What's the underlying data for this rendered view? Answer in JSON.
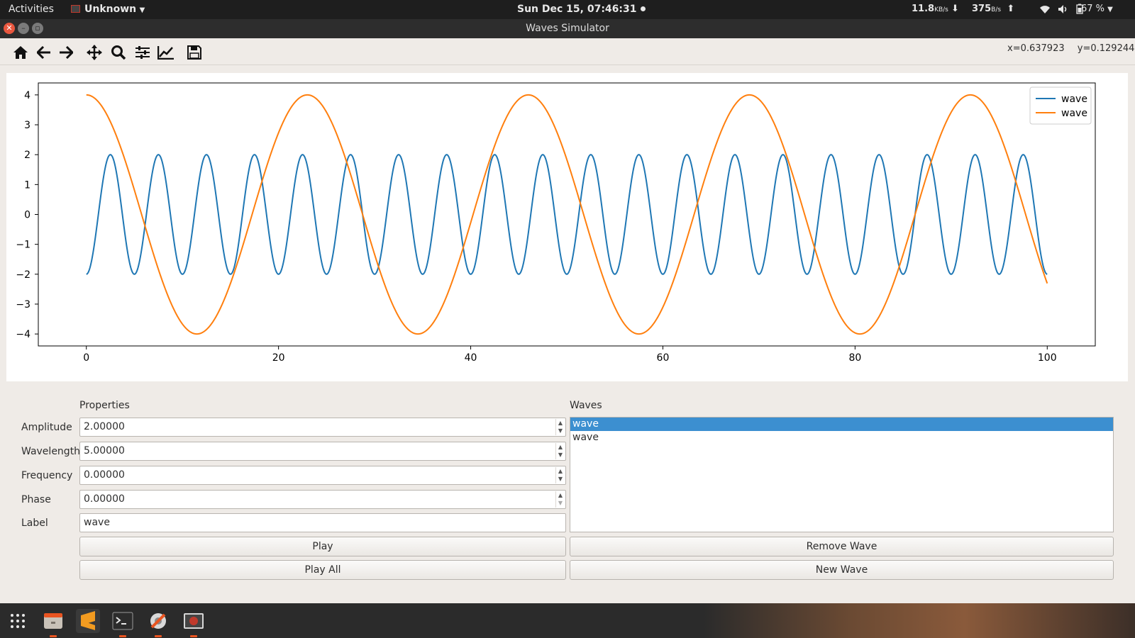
{
  "topbar": {
    "activities": "Activities",
    "app_menu": "Unknown",
    "clock": "Sun Dec 15, 07:46:31",
    "net_down_value": "11.8",
    "net_down_unit": "KB/s",
    "net_up_value": "375",
    "net_up_unit": "B/s",
    "battery": "67 %"
  },
  "window": {
    "title": "Waves Simulator"
  },
  "toolbar": {
    "icons": [
      "home-icon",
      "back-arrow-icon",
      "forward-arrow-icon",
      "pan-icon",
      "zoom-icon",
      "configure-subplots-icon",
      "edit-axis-icon",
      "save-icon"
    ],
    "coord_x": "x=0.637923",
    "coord_y": "y=0.129244"
  },
  "chart_data": {
    "type": "line",
    "title": "",
    "xlabel": "",
    "ylabel": "",
    "xlim": [
      -5,
      105
    ],
    "ylim": [
      -4.4,
      4.4
    ],
    "xticks": [
      0,
      20,
      40,
      60,
      80,
      100
    ],
    "yticks": [
      4,
      3,
      2,
      1,
      0,
      -1,
      -2,
      -3,
      -4
    ],
    "ytick_labels": [
      "4",
      "3",
      "2",
      "1",
      "0",
      "−1",
      "−2",
      "−3",
      "−4"
    ],
    "legend_position": "top-right",
    "grid": false,
    "series": [
      {
        "name": "wave",
        "color": "#1f77b4",
        "amplitude": 2,
        "wavelength": 5,
        "phase": 0,
        "x_range": [
          0,
          100
        ],
        "function": "-A*cos(2*pi*x/wavelength)"
      },
      {
        "name": "wave",
        "color": "#ff7f0e",
        "amplitude": 4,
        "wavelength": 23,
        "phase": 0,
        "x_range": [
          0,
          100
        ],
        "function": "A*cos(2*pi*x/wavelength)"
      }
    ]
  },
  "properties": {
    "header": "Properties",
    "amplitude_label": "Amplitude",
    "amplitude_value": "2.00000",
    "wavelength_label": "Wavelength",
    "wavelength_value": "5.00000",
    "frequency_label": "Frequency",
    "frequency_value": "0.00000",
    "phase_label": "Phase",
    "phase_value": "0.00000",
    "label_label": "Label",
    "label_value": "wave",
    "play_button": "Play",
    "play_all_button": "Play All"
  },
  "waves": {
    "header": "Waves",
    "items": [
      "wave",
      "wave"
    ],
    "selected_index": 0,
    "remove_button": "Remove Wave",
    "new_button": "New Wave"
  },
  "dock": {
    "items": [
      "app-grid-icon",
      "files-icon",
      "sublime-text-icon",
      "terminal-icon",
      "settings-tools-icon",
      "screen-recorder-icon"
    ]
  }
}
